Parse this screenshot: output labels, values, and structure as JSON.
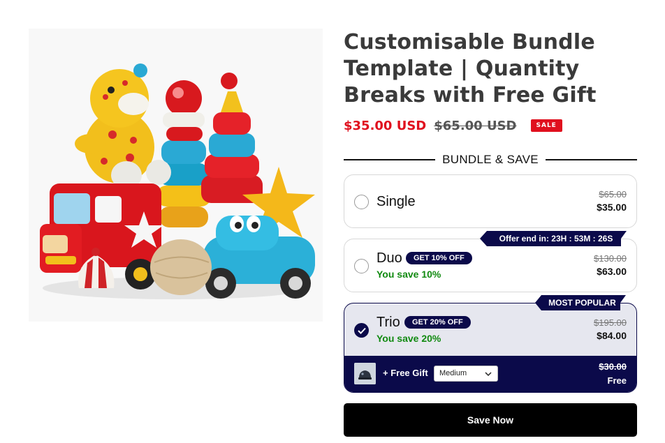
{
  "product": {
    "title": "Customisable Bundle Template | Quantity Breaks with Free Gift",
    "price": "$35.00 USD",
    "compare_price": "$65.00 USD",
    "sale_badge": "SALE",
    "image_alt_icon": "toys-product-image"
  },
  "bundle": {
    "heading": "BUNDLE & SAVE",
    "offer_tag": "Offer end in: 23H : 53M : 26S",
    "popular_tag": "MOST POPULAR",
    "options": [
      {
        "name": "Single",
        "badge": "",
        "savings": "",
        "compare_price": "$65.00",
        "price": "$35.00",
        "selected": false
      },
      {
        "name": "Duo",
        "badge": "GET 10% OFF",
        "savings": "You save 10%",
        "compare_price": "$130.00",
        "price": "$63.00",
        "selected": false
      },
      {
        "name": "Trio",
        "badge": "GET 20% OFF",
        "savings": "You save 20%",
        "compare_price": "$195.00",
        "price": "$84.00",
        "selected": true
      }
    ],
    "gift": {
      "label": "+ Free Gift",
      "size_value": "Medium",
      "compare_price": "$30.00",
      "price": "Free"
    }
  },
  "cta": {
    "label": "Save Now"
  },
  "colors": {
    "accent": "#0b0a4a",
    "sale": "#e0101e",
    "savings": "#118a11"
  }
}
